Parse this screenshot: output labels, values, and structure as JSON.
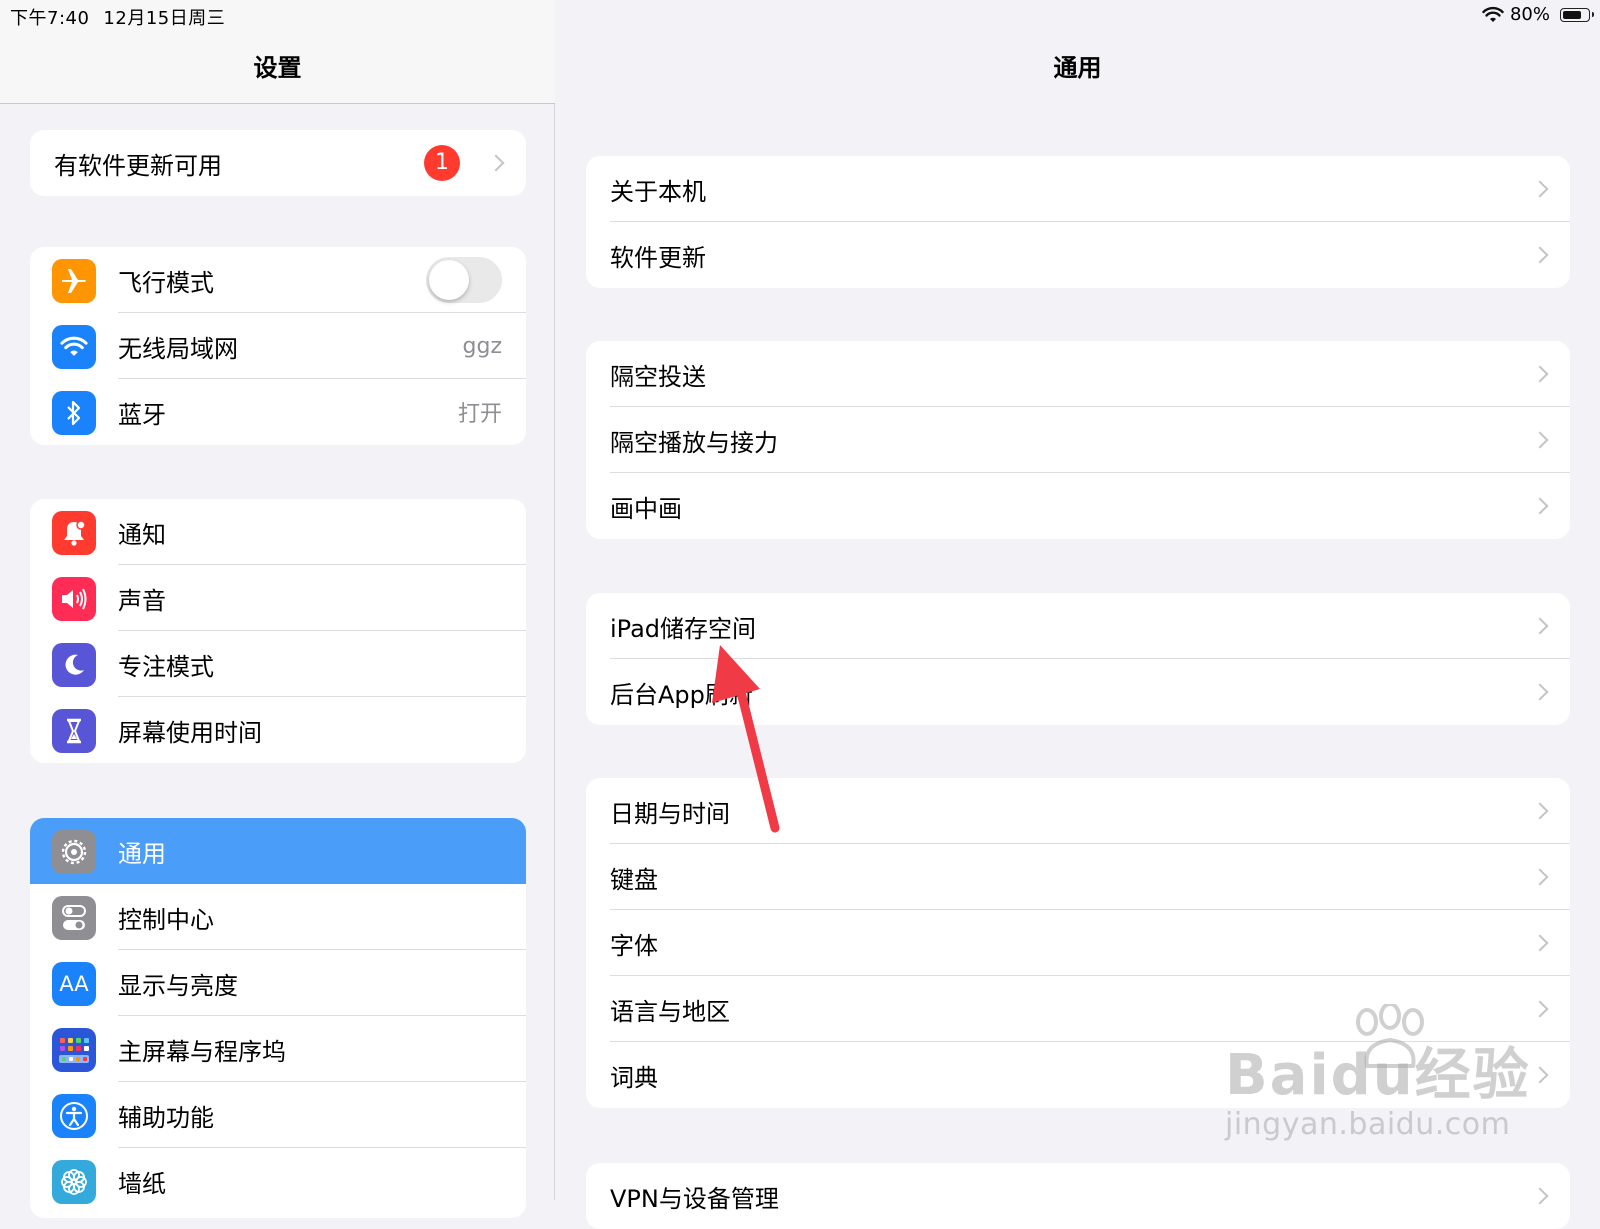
{
  "status_bar": {
    "time": "下午7:40",
    "date": "12月15日周三",
    "battery_text": "80%",
    "battery_level": 0.8
  },
  "sidebar": {
    "title": "设置",
    "update_banner": {
      "label": "有软件更新可用",
      "badge": "1"
    },
    "group_connect": [
      {
        "label": "飞行模式",
        "icon": "airplane-icon",
        "color": "#ff9500",
        "toggle": false
      },
      {
        "label": "无线局域网",
        "value": "ggz",
        "icon": "wifi-icon",
        "color": "#1a82fb"
      },
      {
        "label": "蓝牙",
        "value": "打开",
        "icon": "bluetooth-icon",
        "color": "#1a82fb"
      }
    ],
    "group_notify": [
      {
        "label": "通知",
        "icon": "bell-icon",
        "color": "#ff3b30"
      },
      {
        "label": "声音",
        "icon": "speaker-icon",
        "color": "#ff2d55"
      },
      {
        "label": "专注模式",
        "icon": "moon-icon",
        "color": "#5856d6"
      },
      {
        "label": "屏幕使用时间",
        "icon": "hourglass-icon",
        "color": "#5856d6"
      }
    ],
    "group_general": [
      {
        "label": "通用",
        "icon": "gear-icon",
        "color": "#8e8e93",
        "selected": true
      },
      {
        "label": "控制中心",
        "icon": "switches-icon",
        "color": "#8e8e93"
      },
      {
        "label": "显示与亮度",
        "icon": "text-size-icon",
        "color": "#1a82fb"
      },
      {
        "label": "主屏幕与程序坞",
        "icon": "home-grid-icon",
        "color": "#2c56d9"
      },
      {
        "label": "辅助功能",
        "icon": "accessibility-icon",
        "color": "#1a82fb"
      },
      {
        "label": "墙纸",
        "icon": "flower-icon",
        "color": "#34aadc"
      }
    ]
  },
  "detail": {
    "title": "通用",
    "groups": [
      [
        "关于本机",
        "软件更新"
      ],
      [
        "隔空投送",
        "隔空播放与接力",
        "画中画"
      ],
      [
        "iPad储存空间",
        "后台App刷新"
      ],
      [
        "日期与时间",
        "键盘",
        "字体",
        "语言与地区",
        "词典"
      ],
      [
        "VPN与设备管理"
      ]
    ]
  },
  "annotation": {
    "arrow_color": "#f03a45"
  },
  "watermark": {
    "main": "Baidu经验",
    "sub": "jingyan.baidu.com"
  }
}
